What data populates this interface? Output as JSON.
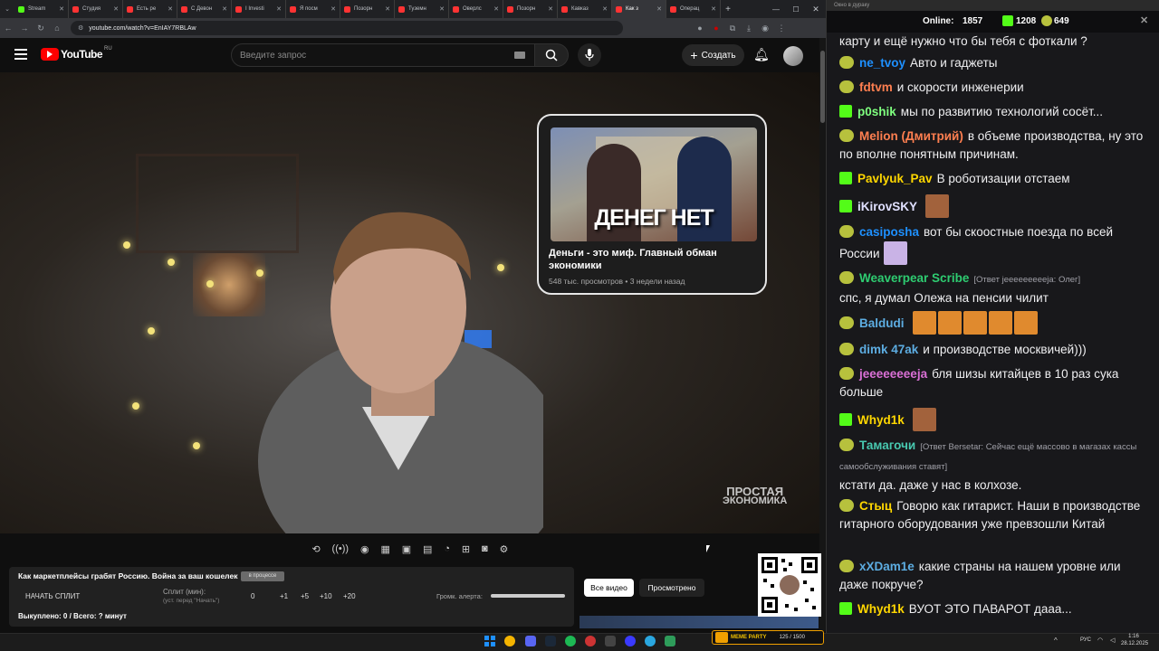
{
  "browser": {
    "tabs": [
      {
        "label": "Stream",
        "color": "#53fc18"
      },
      {
        "label": "Студия",
        "color": "#ff3333"
      },
      {
        "label": "Есть ре",
        "color": "#ff3333"
      },
      {
        "label": "С Девон",
        "color": "#ff3333"
      },
      {
        "label": "I Investi",
        "color": "#ff3333"
      },
      {
        "label": "Я посм",
        "color": "#ff3333"
      },
      {
        "label": "Позорн",
        "color": "#ff3333"
      },
      {
        "label": "Туземн",
        "color": "#ff3333"
      },
      {
        "label": "Оверлс",
        "color": "#ff3333"
      },
      {
        "label": "Позорн",
        "color": "#ff3333"
      },
      {
        "label": "Кавказ",
        "color": "#ff3333"
      },
      {
        "label": "Как з",
        "color": "#ff3333"
      },
      {
        "label": "Операц",
        "color": "#ff3333"
      }
    ],
    "active_tab": 11,
    "url": "youtube.com/watch?v=EnIAY7RBLAw"
  },
  "youtube": {
    "logo": "YouTube",
    "region": "RU",
    "search_placeholder": "Введите запрос",
    "create_label": "Создать"
  },
  "video": {
    "end_card": {
      "thumb_text": "ДЕНЕГ НЕТ",
      "title": "Деньги - это миф. Главный обман экономики",
      "meta": "548 тыс. просмотров • 3 недели назад"
    },
    "watermark_line1": "ПРОСТАЯ",
    "watermark_line2": "ЭКОНОМИКА"
  },
  "extension": {
    "video_title": "Как маркетплейсы грабят Россию. Война за ваш кошелек",
    "badge": "в процессе",
    "start_split": "НАЧАТЬ СПЛИТ",
    "split_label": "Сплит (мин):",
    "split_hint": "(уст. перед \"Начать\")",
    "split_values": [
      "0",
      "+1",
      "+5",
      "+10",
      "+20"
    ],
    "volume_label": "Громк. алерта:",
    "all_videos": "Все видео",
    "watched": "Просмотрено",
    "bought": "Выкуплено: 0 / Всего: ? минут"
  },
  "chat": {
    "window_title": "Окно в дураку",
    "online_label": "Online:",
    "online": "1857",
    "kick_count": "1208",
    "other_count": "649",
    "messages": [
      {
        "nick": "",
        "color": "#efeff1",
        "text": "карту и ещё нужно что бы тебя с фоткали ?",
        "badge": ""
      },
      {
        "nick": "ne_tvoy",
        "color": "#1e90ff",
        "text": "Авто и гаджеты",
        "badge": "p"
      },
      {
        "nick": "fdtvm",
        "color": "#ff7f50",
        "text": "и скорости инженерии",
        "badge": "p"
      },
      {
        "nick": "p0shik",
        "color": "#7fff7f",
        "text": "мы по развитию технологий сосёт...",
        "badge": "k"
      },
      {
        "nick": "Melion (Дмитрий)",
        "color": "#ff7f50",
        "text": "в объеме производства, ну это по вполне понятным причинам.",
        "badge": "p"
      },
      {
        "nick": "Pavlyuk_Pav",
        "color": "#ffd700",
        "text": "В роботизации отстаем",
        "badge": "k"
      },
      {
        "nick": "iKirovSKY",
        "color": "#e0e0ff",
        "text": "",
        "badge": "k"
      },
      {
        "nick": "casiposha",
        "color": "#1e90ff",
        "text": "вот бы скоостные поезда по всей России",
        "badge": "p"
      },
      {
        "nick": "Weaverpear Scribe",
        "color": "#2ecc71",
        "reply": "[Ответ jeeeeeeeeeja: Олег]",
        "text": "спс, я думал Олежа на пенсии чилит",
        "badge": "p"
      },
      {
        "nick": "Baldudi",
        "color": "#5dade2",
        "text": "",
        "badge": "p"
      },
      {
        "nick": "dimk 47ak",
        "color": "#5dade2",
        "text": "и производстве москвичей)))",
        "badge": "p"
      },
      {
        "nick": "jeeeeeeeeja",
        "color": "#da70d6",
        "text": "бля шизы китайцев в 10 раз сука больше",
        "badge": "p"
      },
      {
        "nick": "Whyd1k",
        "color": "#ffd700",
        "text": "",
        "badge": "k"
      },
      {
        "nick": "Тамагочи",
        "color": "#48c9b0",
        "reply": "[Ответ Bersetar: Сейчас ещё массово в магазах кассы самообслуживания ставят]",
        "text": "кстати да. даже у нас в колхозе.",
        "badge": "p"
      },
      {
        "nick": "Стыц",
        "color": "#ffd700",
        "text": "Говорю как гитарист. Наши в производстве гитарного оборудования уже превзошли Китай",
        "badge": "p"
      },
      {
        "nick": "xXDam1e",
        "color": "#5dade2",
        "text": "какие страны на нашем уровне или даже покруче?",
        "badge": "p"
      },
      {
        "nick": "Whyd1k",
        "color": "#ffd700",
        "text": "ВУОТ ЭТО ПАВАРОТ дааа...",
        "badge": "k"
      }
    ]
  },
  "taskbar": {
    "lang": "РУС",
    "time": "1:16",
    "date": "28.12.2025",
    "meme_label": "MEME PARTY",
    "meme_counter": "125 / 1500"
  }
}
